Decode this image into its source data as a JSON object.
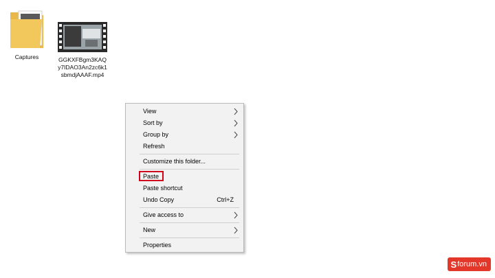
{
  "desktop": {
    "icons": [
      {
        "label": "Captures",
        "type": "folder"
      },
      {
        "label": "GGKXFBgm3KAQy7IDAO3An2zc6k1sbmdjAAAF.mp4",
        "type": "video-file"
      }
    ]
  },
  "context_menu": {
    "items": [
      {
        "label": "View",
        "submenu": true
      },
      {
        "label": "Sort by",
        "submenu": true
      },
      {
        "label": "Group by",
        "submenu": true
      },
      {
        "label": "Refresh"
      },
      {
        "label": "Customize this folder..."
      },
      {
        "label": "Paste",
        "highlighted": true
      },
      {
        "label": "Paste shortcut"
      },
      {
        "label": "Undo Copy",
        "shortcut": "Ctrl+Z"
      },
      {
        "label": "Give access to",
        "submenu": true
      },
      {
        "label": "New",
        "submenu": true
      },
      {
        "label": "Properties"
      }
    ]
  },
  "watermark": {
    "logo_letter": "S",
    "text": "forum.vn"
  },
  "colors": {
    "highlight": "#d0021b",
    "menu_bg": "#f2f2f2",
    "watermark_bg": "#e3372a"
  }
}
